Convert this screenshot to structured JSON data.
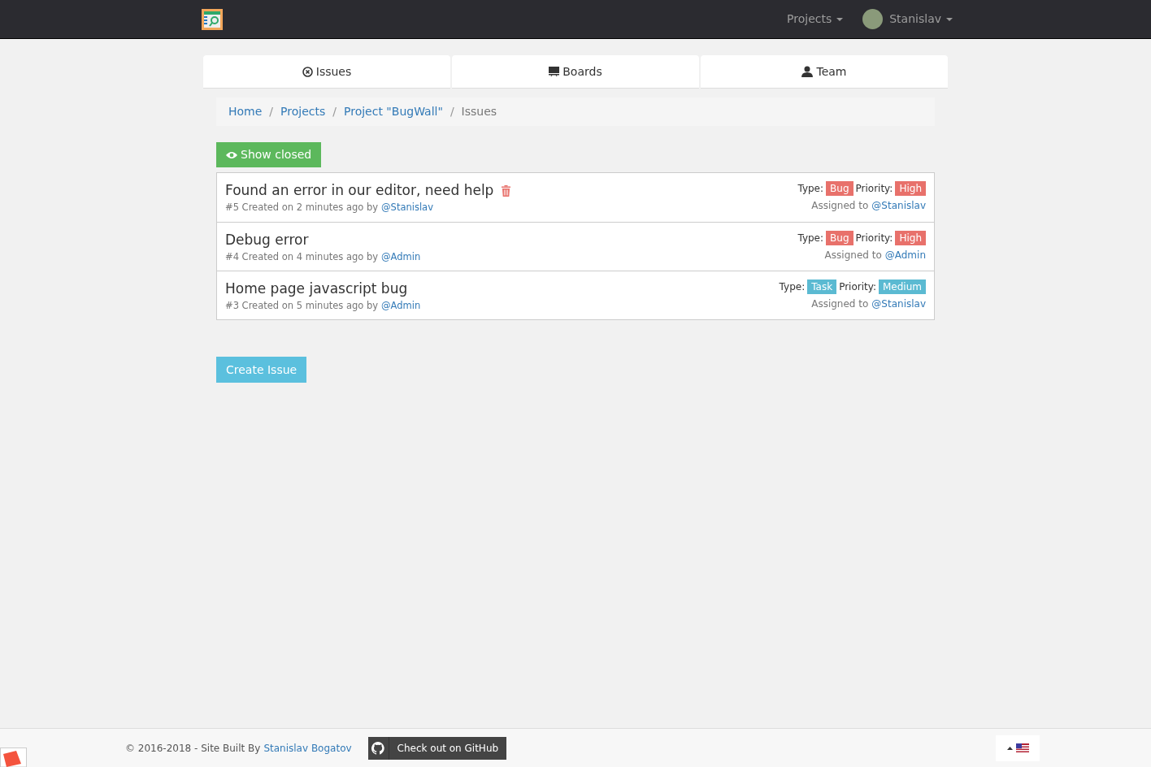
{
  "navbar": {
    "menus": [
      {
        "label": "Projects",
        "kind": "plain"
      },
      {
        "label": "Stanislav",
        "kind": "user"
      }
    ]
  },
  "tabs": [
    {
      "label": "Issues"
    },
    {
      "label": "Boards"
    },
    {
      "label": "Team"
    }
  ],
  "breadcrumb": [
    {
      "kind": "link",
      "label": "Home"
    },
    {
      "kind": "separator",
      "label": "/"
    },
    {
      "kind": "link",
      "label": "Projects"
    },
    {
      "kind": "separator",
      "label": "/"
    },
    {
      "kind": "link",
      "label": "Project \"BugWall\""
    },
    {
      "kind": "separator",
      "label": "/"
    },
    {
      "kind": "current",
      "label": "Issues"
    }
  ],
  "show_closed_button": "Show closed",
  "issues": [
    {
      "title": "Found an error in our editor, need help",
      "deletable": true,
      "meta": "#5 Created on 2 minutes ago by",
      "author": "@Stanislav",
      "type_label": "Type:",
      "type": {
        "text": "Bug",
        "color": "#e8716b"
      },
      "priority_label": "Priority:",
      "priority": {
        "text": "High",
        "color": "#e8716b"
      },
      "assigned_label": "Assigned to",
      "assignee": "@Stanislav"
    },
    {
      "title": "Debug error",
      "deletable": false,
      "meta": "#4 Created on 4 minutes ago by",
      "author": "@Admin",
      "type_label": "Type:",
      "type": {
        "text": "Bug",
        "color": "#e8716b"
      },
      "priority_label": "Priority:",
      "priority": {
        "text": "High",
        "color": "#e8716b"
      },
      "assigned_label": "Assigned to",
      "assignee": "@Admin"
    },
    {
      "title": "Home page javascript bug",
      "deletable": false,
      "meta": "#3 Created on 5 minutes ago by",
      "author": "@Admin",
      "type_label": "Type:",
      "type": {
        "text": "Task",
        "color": "#5bbad2"
      },
      "priority_label": "Priority:",
      "priority": {
        "text": "Medium",
        "color": "#5bbad2"
      },
      "assigned_label": "Assigned to",
      "assignee": "@Stanislav"
    }
  ],
  "create_button": "Create Issue",
  "footer": {
    "copyright": "© 2016-2018 - Site Built By",
    "author_link": "Stanislav Bogatov",
    "github_button": "Check out on GitHub"
  }
}
